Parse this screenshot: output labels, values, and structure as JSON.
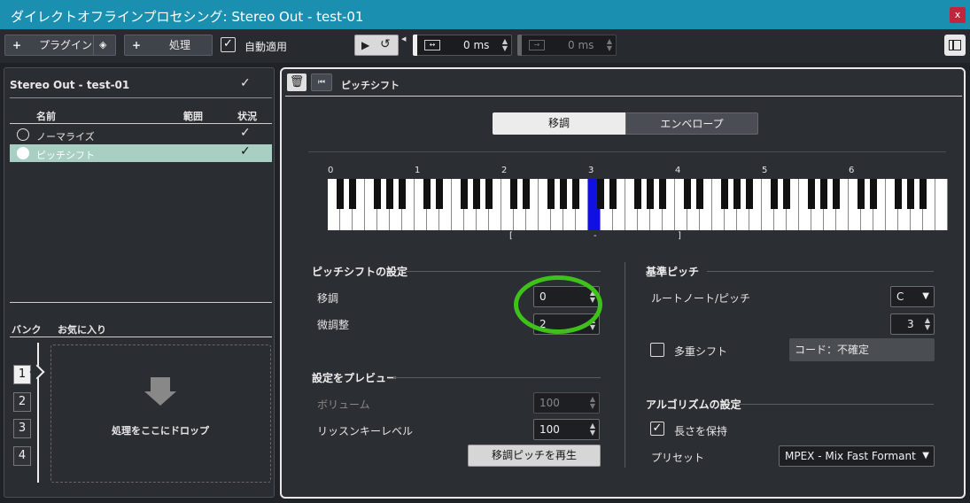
{
  "window": {
    "title": "ダイレクトオフラインプロセシング: Stereo Out - test-01",
    "close": "x"
  },
  "toolbar": {
    "plugin_label": "プラグイン",
    "plus": "+",
    "process_label": "処理",
    "auto_apply_label": "自動適用",
    "time1": "0 ms",
    "time2": "0 ms"
  },
  "left": {
    "track_title": "Stereo Out - test-01",
    "columns": [
      "名前",
      "範囲",
      "状況"
    ],
    "items": [
      {
        "label": "ノーマライズ",
        "checked": true,
        "selected": false
      },
      {
        "label": "ピッチシフト",
        "checked": true,
        "selected": true
      }
    ],
    "bank_label": "バンク",
    "favorites_label": "お気に入り",
    "banks": [
      "1",
      "2",
      "3",
      "4"
    ],
    "drop_label": "処理をここにドロップ"
  },
  "right": {
    "header_title": "ピッチシフト",
    "tabs": [
      "移調",
      "エンベロープ"
    ],
    "active_tab": "移調",
    "octave_labels": [
      "0",
      "1",
      "2",
      "3",
      "4",
      "5",
      "6"
    ],
    "range_markers": [
      "[",
      "-",
      "]"
    ],
    "pitch_shift_section": "ピッチシフトの設定",
    "transpose_label": "移調",
    "transpose_value": "0",
    "fine_label": "微調整",
    "fine_value": "2",
    "preview_section": "設定をプレビュー",
    "volume_label": "ボリューム",
    "volume_value": "100",
    "listen_label": "リッスンキーレベル",
    "listen_value": "100",
    "play_button": "移調ピッチを再生",
    "base_pitch_section": "基準ピッチ",
    "root_label": "ルートノート/ピッチ",
    "root_note": "C",
    "root_octave": "3",
    "multi_shift_label": "多重シフト",
    "chord_text": "コード：不確定",
    "algorithm_section": "アルゴリズムの設定",
    "keep_length_label": "長さを保持",
    "preset_label": "プリセット",
    "preset_value": "MPEX - Mix Fast Formant"
  },
  "colors": {
    "titlebar": "#1b8fb0",
    "highlight_key": "#1010e0",
    "annotation_circle": "#3ec11a",
    "selected_row": "#a8cfc2"
  }
}
